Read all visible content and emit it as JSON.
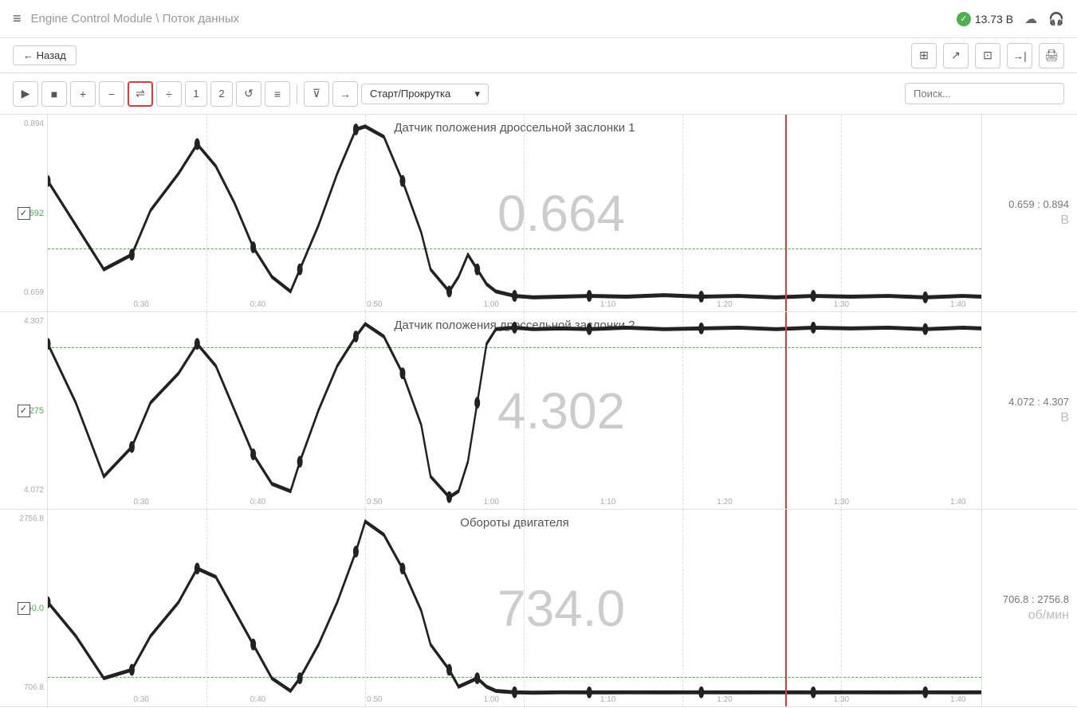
{
  "header": {
    "hamburger": "≡",
    "title": "Engine Control Module",
    "separator": "\\",
    "subtitle": "Поток данных",
    "status_value": "13.73 В",
    "cloud_icon": "☁",
    "headphone_icon": "🎧"
  },
  "navbar": {
    "back_label": "← Назад",
    "icons": [
      "⊞",
      "↗",
      "⊡",
      "→|",
      "🖨"
    ]
  },
  "toolbar": {
    "play_icon": "▶",
    "stop_icon": "■",
    "plus_icon": "+",
    "minus_icon": "−",
    "active_icon": "⇌",
    "divide_icon": "÷",
    "num1": "1",
    "num2": "2",
    "refresh_icon": "↺",
    "menu_icon": "≡",
    "filter_icon": "⊽",
    "arrow_icon": "→",
    "dropdown_label": "Старт/Прокрутка",
    "dropdown_arrow": "▾",
    "search_placeholder": "Поиск..."
  },
  "charts": [
    {
      "id": "chart1",
      "title": "Датчик положения дроссельной заслонки 1",
      "value": "0.664",
      "unit": "В",
      "range": "0.659 : 0.894",
      "y_top": "0.894",
      "y_mid": "0.692",
      "y_bot": "0.659",
      "h_line_pct": 68,
      "times": [
        "0:30",
        "0:40",
        "0:50",
        "1:00",
        "1:10",
        "1:20",
        "1:30",
        "1:40"
      ]
    },
    {
      "id": "chart2",
      "title": "Датчик положения дроссельной заслонки 2",
      "value": "4.302",
      "unit": "В",
      "range": "4.072 : 4.307",
      "y_top": "4.307",
      "y_mid": "4.275",
      "y_bot": "4.072",
      "h_line_pct": 18,
      "times": [
        "0:30",
        "0:40",
        "0:50",
        "1:00",
        "1:10",
        "1:20",
        "1:30",
        "1:40"
      ]
    },
    {
      "id": "chart3",
      "title": "Обороты двигателя",
      "value": "734.0",
      "unit": "об/мин",
      "range": "706.8 : 2756.8",
      "y_top": "2756.8",
      "y_mid": "950.0",
      "y_bot": "706.8",
      "h_line_pct": 85,
      "times": [
        "0:30",
        "0:40",
        "0:50",
        "1:00",
        "1:10",
        "1:20",
        "1:30",
        "1:40"
      ]
    }
  ]
}
